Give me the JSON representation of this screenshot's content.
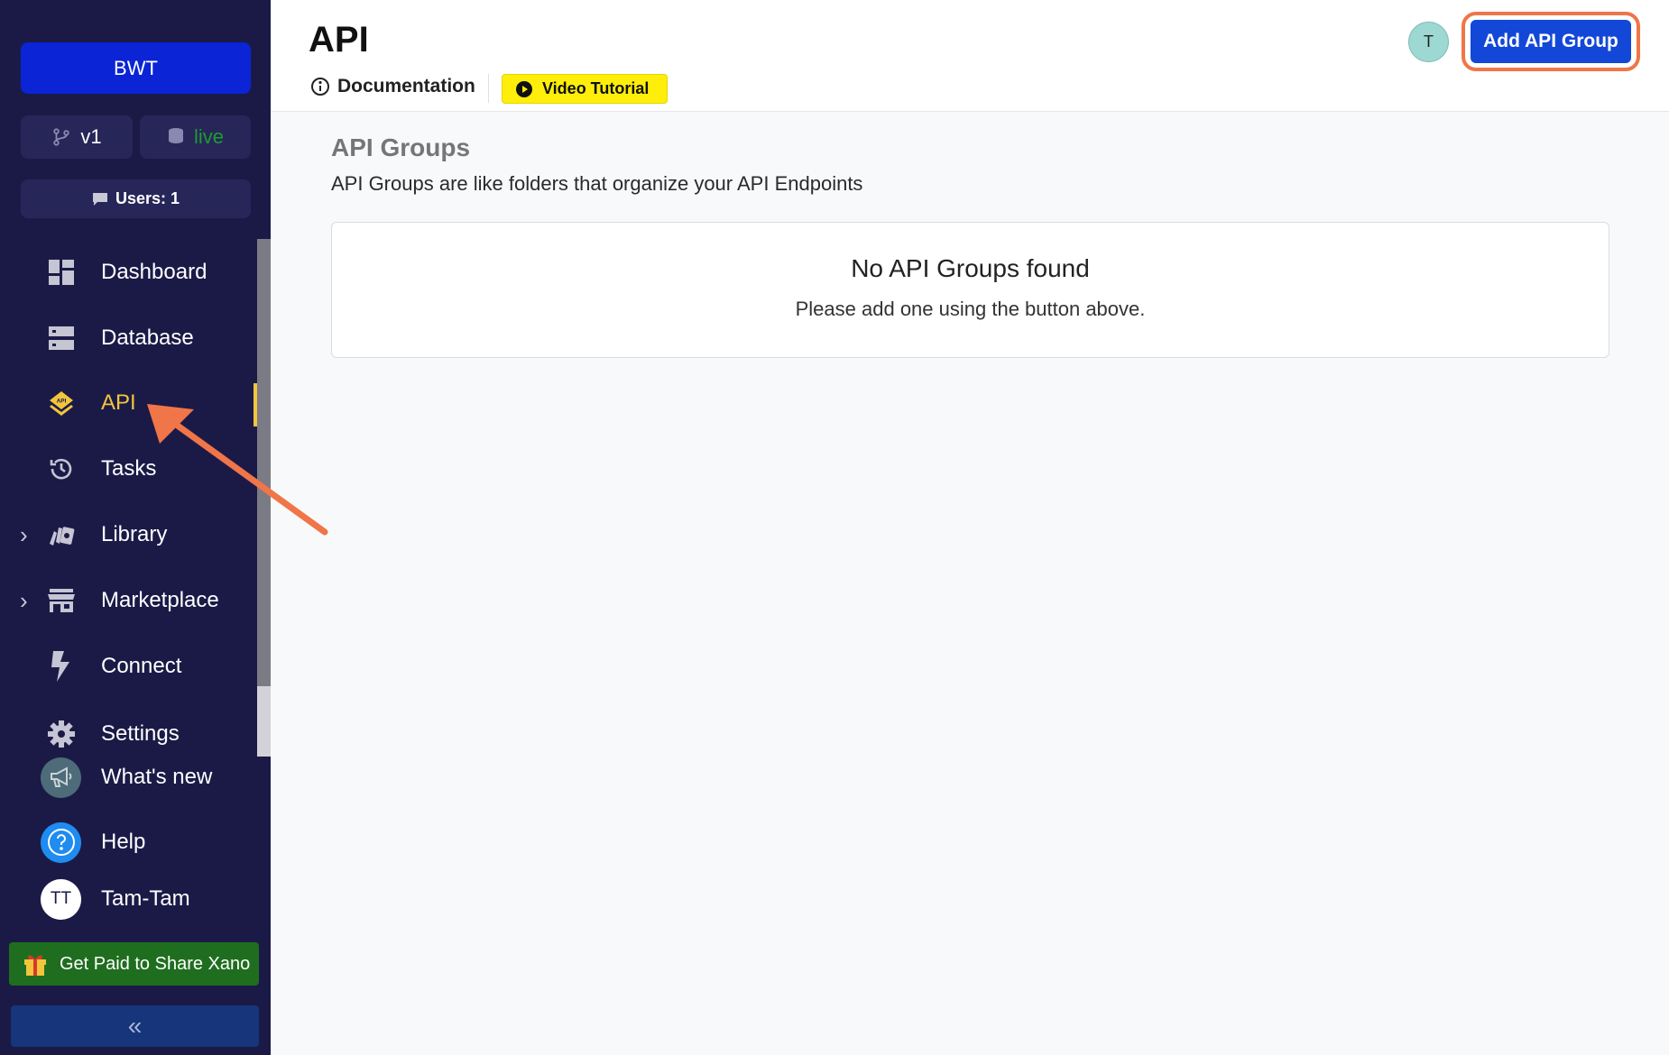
{
  "sidebar": {
    "workspace": "BWT",
    "branch": "v1",
    "env": "live",
    "users": "Users: 1",
    "nav": [
      {
        "label": "Dashboard",
        "icon": "dashboard-icon"
      },
      {
        "label": "Database",
        "icon": "database-icon"
      },
      {
        "label": "API",
        "icon": "api-icon"
      },
      {
        "label": "Tasks",
        "icon": "history-icon"
      },
      {
        "label": "Library",
        "icon": "library-icon"
      },
      {
        "label": "Marketplace",
        "icon": "store-icon"
      },
      {
        "label": "Connect",
        "icon": "bolt-icon"
      },
      {
        "label": "Settings",
        "icon": "gear-icon"
      }
    ],
    "whats_new": "What's new",
    "help": "Help",
    "user_name": "Tam-Tam",
    "user_initials": "TT",
    "promo": "Get Paid to Share Xano",
    "collapse": "«"
  },
  "header": {
    "title": "API",
    "documentation": "Documentation",
    "video_tutorial": "Video Tutorial",
    "user_initial": "T",
    "add_button": "Add API Group"
  },
  "main": {
    "section_title": "API Groups",
    "section_desc": "API Groups are like folders that organize your API Endpoints",
    "empty_title": "No API Groups found",
    "empty_sub": "Please add one using the button above."
  },
  "colors": {
    "sidebar_bg": "#1b1a47",
    "accent_blue": "#1347d8",
    "active_nav": "#f2c53d",
    "highlight": "#f07548",
    "video_yellow": "#ffee0a"
  }
}
